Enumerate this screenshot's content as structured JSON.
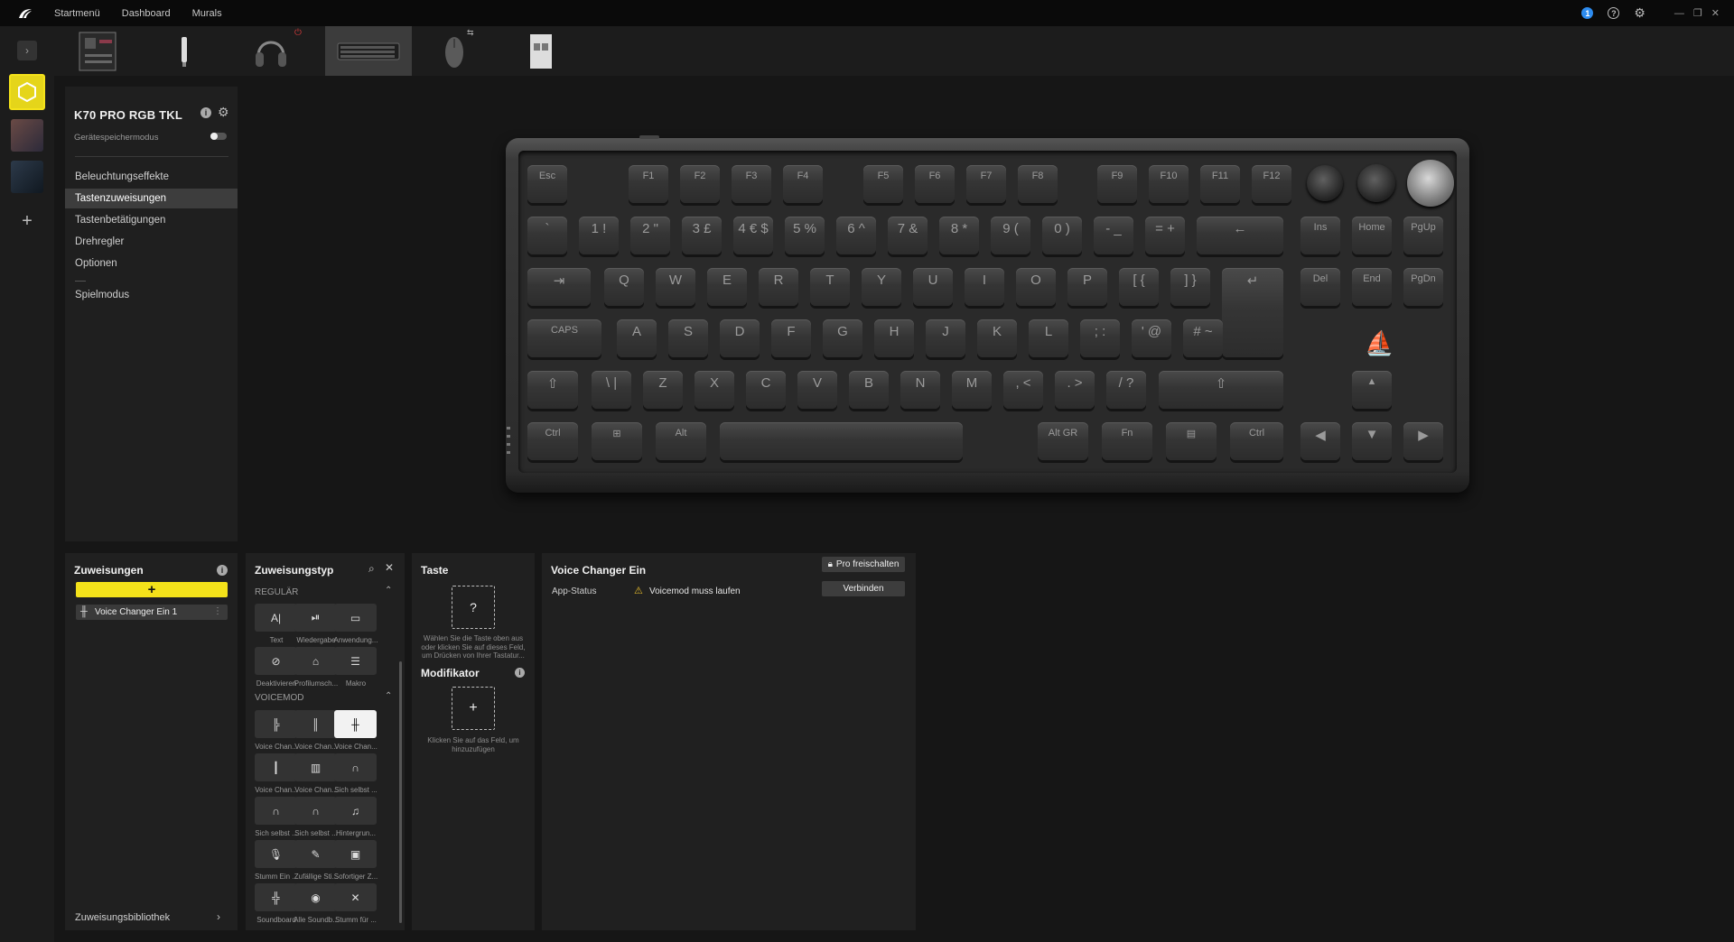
{
  "topbar": {
    "nav": [
      "Startmenü",
      "Dashboard",
      "Murals"
    ]
  },
  "device": {
    "name": "K70 PRO RGB TKL",
    "storage_mode_label": "Gerätespeichermodus",
    "menu": [
      "Beleuchtungseffekte",
      "Tastenzuweisungen",
      "Tastenbetätigungen",
      "Drehregler",
      "Optionen",
      "Spielmodus"
    ],
    "active_menu": "Tastenzuweisungen"
  },
  "keyboard": {
    "row1": [
      "Esc",
      "F1",
      "F2",
      "F3",
      "F4",
      "F5",
      "F6",
      "F7",
      "F8",
      "F9",
      "F10",
      "F11",
      "F12"
    ],
    "row2": [
      "`",
      "1 !",
      "2 \"",
      "3 £",
      "4 € $",
      "5 %",
      "6 ^",
      "7 &",
      "8 *",
      "9 (",
      "0 )",
      "- _",
      "= +",
      "←",
      "Ins",
      "Home",
      "PgUp"
    ],
    "row3": [
      "⇥",
      "Q",
      "W",
      "E",
      "R",
      "T",
      "Y",
      "U",
      "I",
      "O",
      "P",
      "[ {",
      "] }",
      "↵",
      "Del",
      "End",
      "PgDn"
    ],
    "row4": [
      "CAPS",
      "A",
      "S",
      "D",
      "F",
      "G",
      "H",
      "J",
      "K",
      "L",
      "; :",
      "' @",
      "# ~"
    ],
    "row5": [
      "⇧",
      "\\ |",
      "Z",
      "X",
      "C",
      "V",
      "B",
      "N",
      "M",
      ", <",
      ". >",
      "/ ?",
      "⇧",
      "▲"
    ],
    "row6": [
      "Ctrl",
      "⊞",
      "Alt",
      "",
      "Alt GR",
      "Fn",
      "▤",
      "Ctrl",
      "◀",
      "▼",
      "▶"
    ]
  },
  "assignments": {
    "title": "Zuweisungen",
    "add_label": "+",
    "items": [
      "Voice Changer Ein 1"
    ],
    "library_label": "Zuweisungsbibliothek"
  },
  "assignment_type": {
    "title": "Zuweisungstyp",
    "regular_label": "REGULÄR",
    "regular": [
      {
        "icon": "A|",
        "label": "Text"
      },
      {
        "icon": "⏯",
        "label": "Wiedergabe"
      },
      {
        "icon": "▭",
        "label": "Anwendung..."
      },
      {
        "icon": "⊘",
        "label": "Deaktivieren"
      },
      {
        "icon": "⌂",
        "label": "Profilumsch..."
      },
      {
        "icon": "☰",
        "label": "Makro"
      }
    ],
    "voicemod_label": "VOICEMOD",
    "voicemod": [
      {
        "icon": "╠",
        "label": "Voice Chan..."
      },
      {
        "icon": "║",
        "label": "Voice Chan..."
      },
      {
        "icon": "╫",
        "label": "Voice Chan..."
      },
      {
        "icon": "┃",
        "label": "Voice Chan..."
      },
      {
        "icon": "▥",
        "label": "Voice Chan..."
      },
      {
        "icon": "∩",
        "label": "Sich selbst ..."
      },
      {
        "icon": "∩",
        "label": "Sich selbst ..."
      },
      {
        "icon": "∩",
        "label": "Sich selbst ..."
      },
      {
        "icon": "♫",
        "label": "Hintergrun..."
      },
      {
        "icon": "🎙",
        "label": "Stumm Ein ..."
      },
      {
        "icon": "✎",
        "label": "Zufällige Sti..."
      },
      {
        "icon": "▣",
        "label": "Sofortiger Z..."
      },
      {
        "icon": "╬",
        "label": "Soundboard"
      },
      {
        "icon": "◉",
        "label": "Alle Soundb..."
      },
      {
        "icon": "✕",
        "label": "Stumm für ..."
      }
    ]
  },
  "key_panel": {
    "title": "Taste",
    "placeholder": "?",
    "hint": "Wählen Sie die Taste oben aus oder klicken Sie auf dieses Feld, um Drücken von Ihrer Tastatur...",
    "modifier_title": "Modifikator",
    "modifier_placeholder": "+",
    "modifier_hint": "Klicken Sie auf das Feld, um hinzuzufügen"
  },
  "voice_changer": {
    "title": "Voice Changer Ein",
    "pro_label": "Pro freischalten",
    "status_label": "App-Status",
    "status_value": "Voicemod muss laufen",
    "connect_label": "Verbinden"
  },
  "colors": {
    "accent": "#f4e21a",
    "bg": "#161616",
    "panel": "#202020",
    "info": "#2d8cf0",
    "warning": "#e3b92b"
  }
}
